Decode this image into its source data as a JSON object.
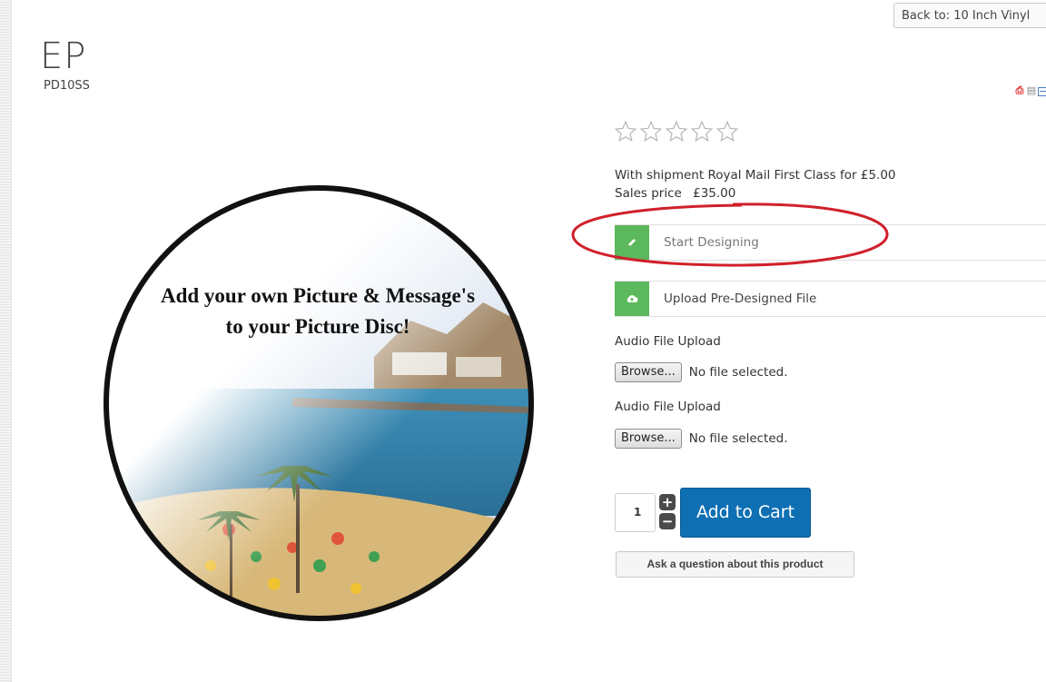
{
  "product": {
    "title": "EP",
    "sku": "PD10SS",
    "back_label": "Back to: 10 Inch Vinyl",
    "image_caption_line1": "Add your own Picture & Message's",
    "image_caption_line2": "to your Picture Disc!",
    "rating": {
      "stars_filled": 0,
      "stars_total": 5
    },
    "shipping": "With shipment Royal Mail First Class for £5.00",
    "price_label": "Sales price",
    "price_value": "£35.00"
  },
  "tools": {
    "icons": [
      "pdf-icon",
      "print-icon",
      "email-icon"
    ]
  },
  "options": {
    "design_label": "Start Designing",
    "upload_label": "Upload Pre-Designed File"
  },
  "audio_uploads": [
    {
      "label": "Audio File Upload",
      "browse_label": "Browse...",
      "status": "No file selected."
    },
    {
      "label": "Audio File Upload",
      "browse_label": "Browse...",
      "status": "No file selected."
    }
  ],
  "cart": {
    "quantity": "1",
    "plus_symbol": "+",
    "minus_symbol": "−",
    "add_label": "Add to Cart",
    "ask_label": "Ask a question about this product"
  },
  "colors": {
    "accent_green": "#5cb85c",
    "cart_blue": "#0f6fb3",
    "annotation_red": "#d0202a"
  }
}
